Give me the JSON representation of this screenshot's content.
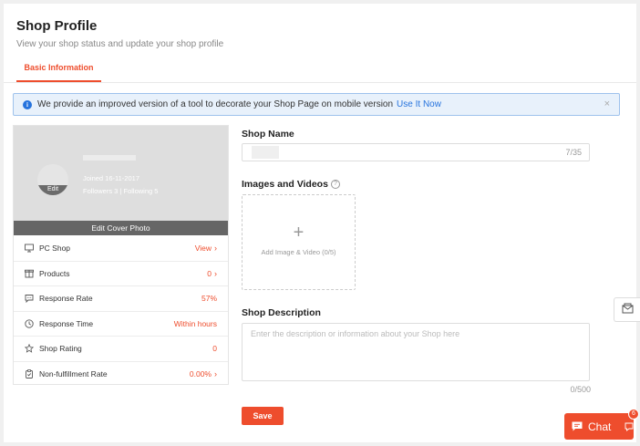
{
  "header": {
    "title": "Shop Profile",
    "subtitle": "View your shop status and update your shop profile"
  },
  "tabs": [
    {
      "label": "Basic Information",
      "active": true
    }
  ],
  "banner": {
    "text": "We provide an improved version of a tool to decorate your Shop Page on mobile version",
    "link": "Use It Now",
    "close": "×"
  },
  "profile": {
    "avatar_edit": "Edit",
    "joined": "Joined 16-11-2017",
    "followers": "Followers 3",
    "following": "Following 5",
    "edit_cover": "Edit Cover Photo",
    "stats": [
      {
        "label": "PC Shop",
        "value": "View",
        "icon": "monitor-icon",
        "chevron": true
      },
      {
        "label": "Products",
        "value": "0",
        "icon": "box-icon",
        "chevron": true
      },
      {
        "label": "Response Rate",
        "value": "57%",
        "icon": "chat-bubble-icon",
        "chevron": false
      },
      {
        "label": "Response Time",
        "value": "Within hours",
        "icon": "clock-icon",
        "chevron": false
      },
      {
        "label": "Shop Rating",
        "value": "0",
        "icon": "star-icon",
        "chevron": false
      },
      {
        "label": "Non-fulfillment Rate",
        "value": "0.00%",
        "icon": "clipboard-icon",
        "chevron": true
      }
    ]
  },
  "form": {
    "shop_name_label": "Shop Name",
    "shop_name_count": "7/35",
    "images_label": "Images and Videos",
    "help_icon": "?",
    "upload_plus": "+",
    "upload_label": "Add Image & Video (0/5)",
    "description_label": "Shop Description",
    "description_placeholder": "Enter the description or information about your Shop here",
    "description_count": "0/500",
    "save_label": "Save"
  },
  "chat": {
    "label": "Chat",
    "badge": "6"
  },
  "colors": {
    "accent": "#ee4d2d",
    "link": "#2673dd",
    "banner_bg": "#e8f1fb"
  }
}
